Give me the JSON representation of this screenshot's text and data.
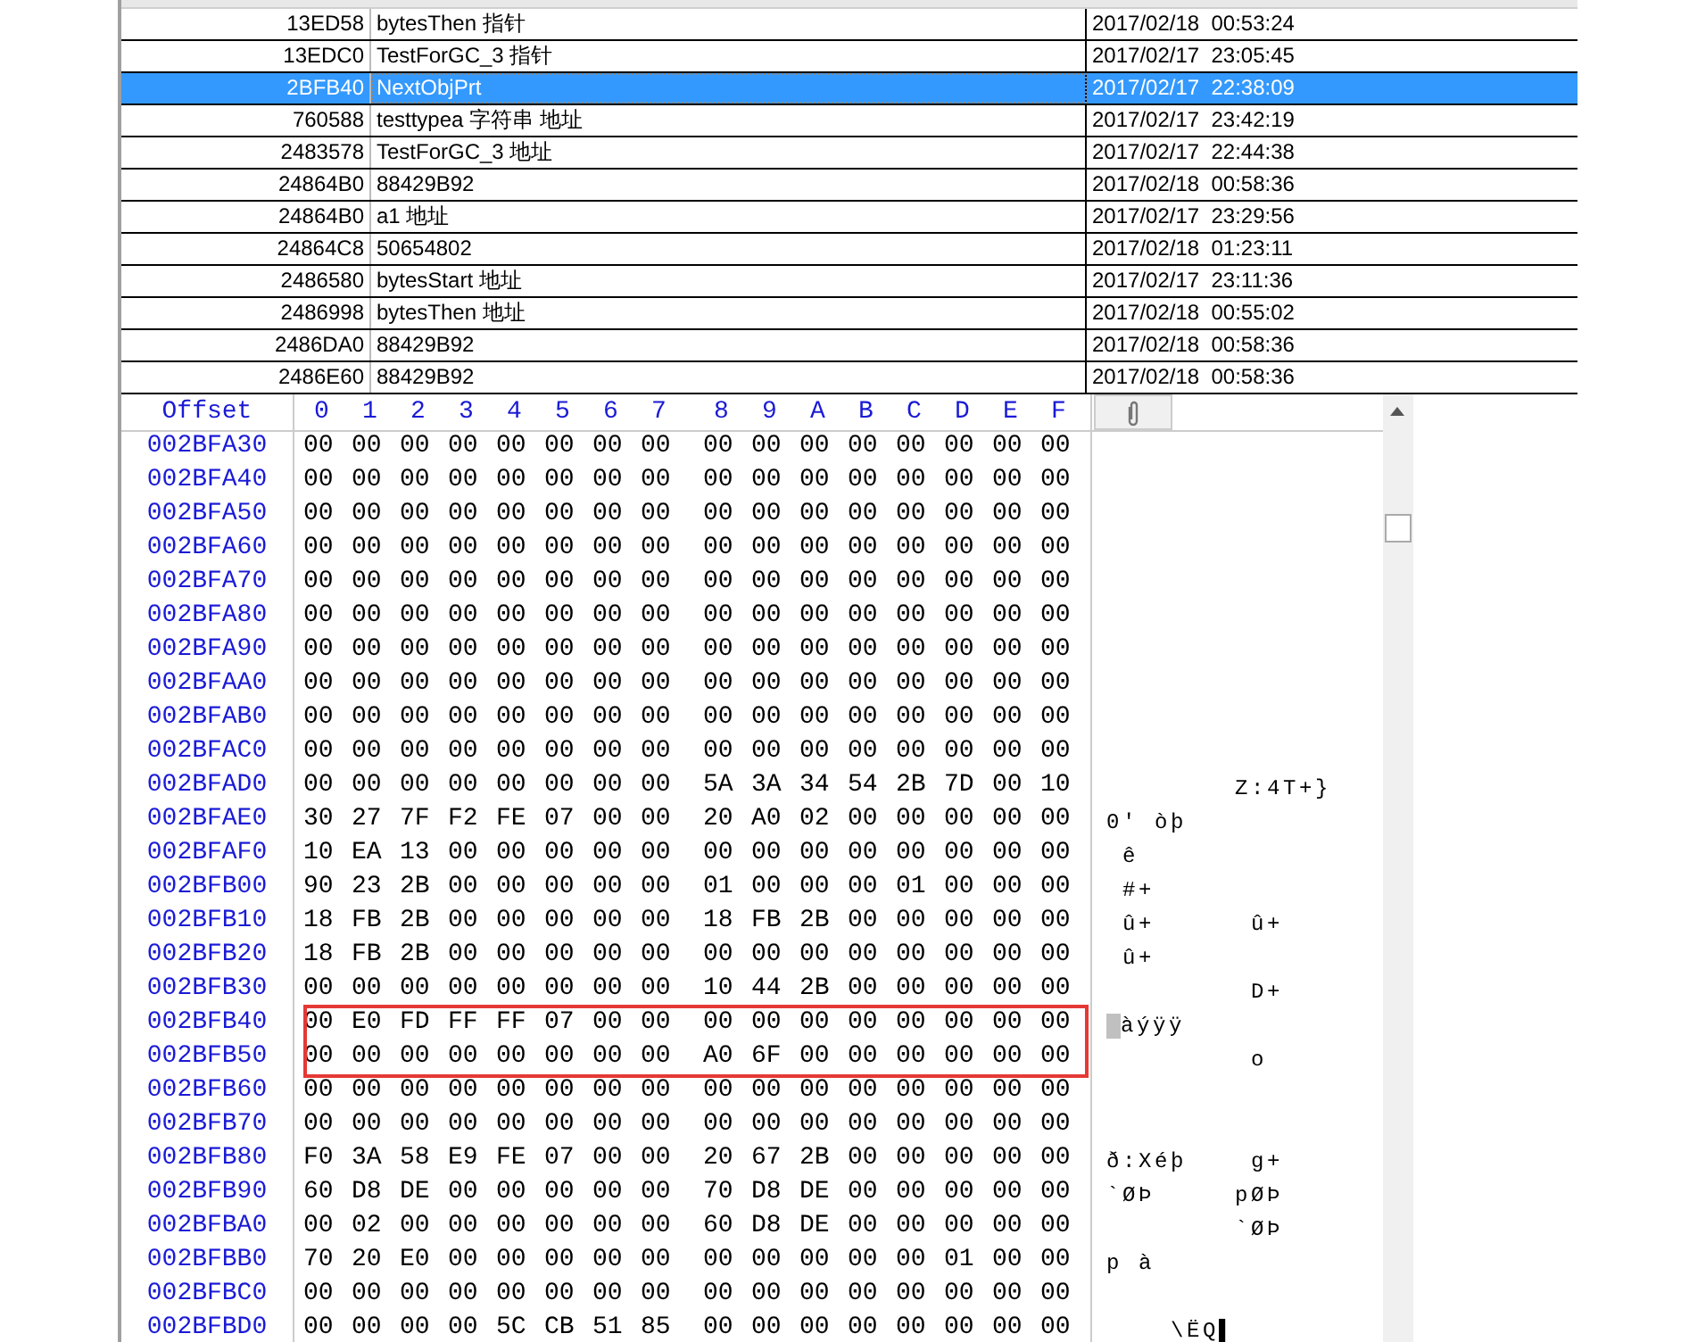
{
  "objects": [
    {
      "address": "13ED58",
      "name": "bytesThen 指针",
      "time": "2017/02/18  00:53:24",
      "selected": false
    },
    {
      "address": "13EDC0",
      "name": "TestForGC_3  指针",
      "time": "2017/02/17  23:05:45",
      "selected": false
    },
    {
      "address": "2BFB40",
      "name": "NextObjPrt",
      "time": "2017/02/17  22:38:09",
      "selected": true
    },
    {
      "address": "760588",
      "name": "testtypea 字符串 地址",
      "time": "2017/02/17  23:42:19",
      "selected": false
    },
    {
      "address": "2483578",
      "name": "TestForGC_3 地址",
      "time": "2017/02/17  22:44:38",
      "selected": false
    },
    {
      "address": "24864B0",
      "name": "88429B92",
      "time": "2017/02/18  00:58:36",
      "selected": false
    },
    {
      "address": "24864B0",
      "name": "a1 地址",
      "time": "2017/02/17  23:29:56",
      "selected": false
    },
    {
      "address": "24864C8",
      "name": "50654802",
      "time": "2017/02/18  01:23:11",
      "selected": false
    },
    {
      "address": "2486580",
      "name": "bytesStart 地址",
      "time": "2017/02/17  23:11:36",
      "selected": false
    },
    {
      "address": "2486998",
      "name": "bytesThen 地址",
      "time": "2017/02/18  00:55:02",
      "selected": false
    },
    {
      "address": "2486DA0",
      "name": "88429B92",
      "time": "2017/02/18  00:58:36",
      "selected": false
    },
    {
      "address": "2486E60",
      "name": "88429B92",
      "time": "2017/02/18  00:58:36",
      "selected": false
    }
  ],
  "hex": {
    "offset_header": "Offset",
    "columns": [
      "0",
      "1",
      "2",
      "3",
      "4",
      "5",
      "6",
      "7",
      "8",
      "9",
      "A",
      "B",
      "C",
      "D",
      "E",
      "F"
    ],
    "rows": [
      {
        "offset": "002BFA30",
        "bytes": "00 00 00 00 00 00 00 00 00 00 00 00 00 00 00 00",
        "ascii": "",
        "boxed": false,
        "cursor": false
      },
      {
        "offset": "002BFA40",
        "bytes": "00 00 00 00 00 00 00 00 00 00 00 00 00 00 00 00",
        "ascii": "",
        "boxed": false,
        "cursor": false
      },
      {
        "offset": "002BFA50",
        "bytes": "00 00 00 00 00 00 00 00 00 00 00 00 00 00 00 00",
        "ascii": "",
        "boxed": false,
        "cursor": false
      },
      {
        "offset": "002BFA60",
        "bytes": "00 00 00 00 00 00 00 00 00 00 00 00 00 00 00 00",
        "ascii": "",
        "boxed": false,
        "cursor": false
      },
      {
        "offset": "002BFA70",
        "bytes": "00 00 00 00 00 00 00 00 00 00 00 00 00 00 00 00",
        "ascii": "",
        "boxed": false,
        "cursor": false
      },
      {
        "offset": "002BFA80",
        "bytes": "00 00 00 00 00 00 00 00 00 00 00 00 00 00 00 00",
        "ascii": "",
        "boxed": false,
        "cursor": false
      },
      {
        "offset": "002BFA90",
        "bytes": "00 00 00 00 00 00 00 00 00 00 00 00 00 00 00 00",
        "ascii": "",
        "boxed": false,
        "cursor": false
      },
      {
        "offset": "002BFAA0",
        "bytes": "00 00 00 00 00 00 00 00 00 00 00 00 00 00 00 00",
        "ascii": "",
        "boxed": false,
        "cursor": false
      },
      {
        "offset": "002BFAB0",
        "bytes": "00 00 00 00 00 00 00 00 00 00 00 00 00 00 00 00",
        "ascii": "",
        "boxed": false,
        "cursor": false
      },
      {
        "offset": "002BFAC0",
        "bytes": "00 00 00 00 00 00 00 00 00 00 00 00 00 00 00 00",
        "ascii": "",
        "boxed": false,
        "cursor": false
      },
      {
        "offset": "002BFAD0",
        "bytes": "00 00 00 00 00 00 00 00 5A 3A 34 54 2B 7D 00 10",
        "ascii": "        Z:4T+}",
        "boxed": false,
        "cursor": false
      },
      {
        "offset": "002BFAE0",
        "bytes": "30 27 7F F2 FE 07 00 00 20 A0 02 00 00 00 00 00",
        "ascii": "0' òþ",
        "boxed": false,
        "cursor": false
      },
      {
        "offset": "002BFAF0",
        "bytes": "10 EA 13 00 00 00 00 00 00 00 00 00 00 00 00 00",
        "ascii": " ê",
        "boxed": false,
        "cursor": false
      },
      {
        "offset": "002BFB00",
        "bytes": "90 23 2B 00 00 00 00 00 01 00 00 00 01 00 00 00",
        "ascii": " #+",
        "boxed": false,
        "cursor": false
      },
      {
        "offset": "002BFB10",
        "bytes": "18 FB 2B 00 00 00 00 00 18 FB 2B 00 00 00 00 00",
        "ascii": " û+      û+",
        "boxed": false,
        "cursor": false
      },
      {
        "offset": "002BFB20",
        "bytes": "18 FB 2B 00 00 00 00 00 00 00 00 00 00 00 00 00",
        "ascii": " û+",
        "boxed": false,
        "cursor": false
      },
      {
        "offset": "002BFB30",
        "bytes": "00 00 00 00 00 00 00 00 10 44 2B 00 00 00 00 00",
        "ascii": "         D+",
        "boxed": false,
        "cursor": false
      },
      {
        "offset": "002BFB40",
        "bytes": "00 E0 FD FF FF 07 00 00 00 00 00 00 00 00 00 00",
        "ascii": "àýÿÿ",
        "boxed": true,
        "cursor": true
      },
      {
        "offset": "002BFB50",
        "bytes": "00 00 00 00 00 00 00 00 A0 6F 00 00 00 00 00 00",
        "ascii": "         o",
        "boxed": true,
        "cursor": false
      },
      {
        "offset": "002BFB60",
        "bytes": "00 00 00 00 00 00 00 00 00 00 00 00 00 00 00 00",
        "ascii": "",
        "boxed": false,
        "cursor": false
      },
      {
        "offset": "002BFB70",
        "bytes": "00 00 00 00 00 00 00 00 00 00 00 00 00 00 00 00",
        "ascii": "",
        "boxed": false,
        "cursor": false
      },
      {
        "offset": "002BFB80",
        "bytes": "F0 3A 58 E9 FE 07 00 00 20 67 2B 00 00 00 00 00",
        "ascii": "ð:Xéþ    g+",
        "boxed": false,
        "cursor": false
      },
      {
        "offset": "002BFB90",
        "bytes": "60 D8 DE 00 00 00 00 00 70 D8 DE 00 00 00 00 00",
        "ascii": "`ØÞ     pØÞ",
        "boxed": false,
        "cursor": false
      },
      {
        "offset": "002BFBA0",
        "bytes": "00 02 00 00 00 00 00 00 60 D8 DE 00 00 00 00 00",
        "ascii": "        `ØÞ",
        "boxed": false,
        "cursor": false
      },
      {
        "offset": "002BFBB0",
        "bytes": "70 20 E0 00 00 00 00 00 00 00 00 00 00 01 00 00",
        "ascii": "p à",
        "boxed": false,
        "cursor": false
      },
      {
        "offset": "002BFBC0",
        "bytes": "00 00 00 00 00 00 00 00 00 00 00 00 00 00 00 00",
        "ascii": "",
        "boxed": false,
        "cursor": false
      },
      {
        "offset": "002BFBD0",
        "bytes": "00 00 00 00 5C CB 51 85 00 00 00 00 00 00 00 00",
        "ascii": "    \\ËQ▌",
        "boxed": false,
        "cursor": false
      }
    ]
  }
}
